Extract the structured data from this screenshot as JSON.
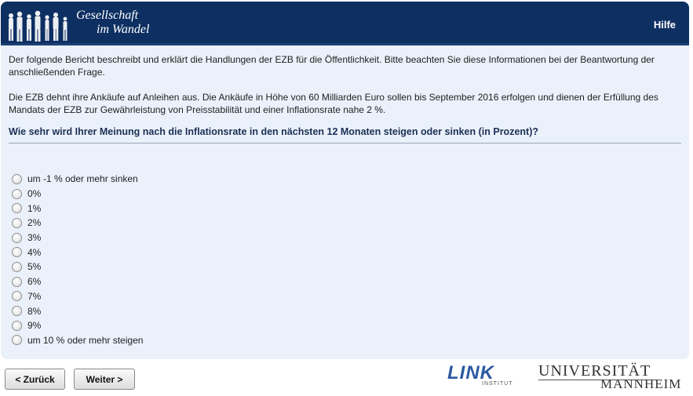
{
  "header": {
    "logo_line1": "Gesellschaft",
    "logo_line2": "im Wandel",
    "help_label": "Hilfe"
  },
  "content": {
    "paragraph1": "Der folgende Bericht beschreibt und erklärt die Handlungen der EZB für die Öffentlichkeit. Bitte beachten Sie diese Informationen bei der Beantwortung der anschließenden Frage.",
    "paragraph2": "Die EZB dehnt ihre Ankäufe auf Anleihen aus. Die Ankäufe in Höhe von 60 Milliarden Euro sollen bis September 2016 erfolgen und dienen der Erfüllung des Mandats der EZB zur Gewährleistung von Preisstabilität und einer Inflationsrate nahe 2 %.",
    "question": "Wie sehr wird Ihrer Meinung nach die Inflationsrate in den nächsten 12 Monaten steigen oder sinken (in Prozent)?"
  },
  "options": [
    "um -1 % oder mehr sinken",
    "0%",
    "1%",
    "2%",
    "3%",
    "4%",
    "5%",
    "6%",
    "7%",
    "8%",
    "9%",
    "um 10 % oder mehr steigen"
  ],
  "nav": {
    "back_label": "< Zurück",
    "next_label": "Weiter >"
  },
  "footer": {
    "link_logo": "LINK",
    "link_sub": "INSTITUT",
    "uni_line1": "UNIVERSITÄT",
    "uni_line2": "MANNHEIM"
  },
  "colors": {
    "header_bg": "#0d2f62",
    "panel_bg": "#eaf1fa",
    "question_text": "#1c2f55"
  }
}
